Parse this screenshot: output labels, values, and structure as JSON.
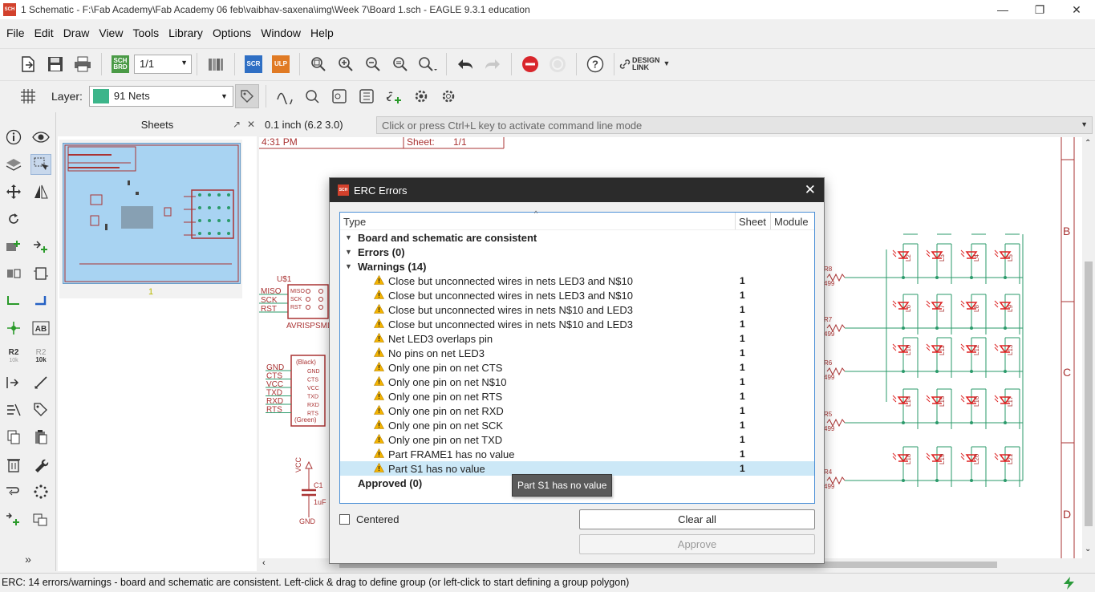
{
  "window": {
    "title": "1 Schematic - F:\\Fab Academy\\Fab Academy 06 feb\\vaibhav-saxena\\img\\Week 7\\Board 1.sch - EAGLE 9.3.1 education",
    "app_icon_text": "SCH",
    "minimize": "—",
    "restore": "❐",
    "close": "✕"
  },
  "menu": [
    "File",
    "Edit",
    "Draw",
    "View",
    "Tools",
    "Library",
    "Options",
    "Window",
    "Help"
  ],
  "toolbar": {
    "sheet_value": "1/1",
    "brd_badge": "SCH BRD",
    "scr_badge": "SCR",
    "ulp_badge": "ULP",
    "design_link_line1": "DESIGN",
    "design_link_line2": "LINK",
    "help_glyph": "?",
    "layer_label": "Layer:",
    "layer_value": "91 Nets",
    "layer_color": "#3cb58a"
  },
  "sheets_panel": {
    "title": "Sheets",
    "sheet_number": "1",
    "restore_glyph": "↗",
    "close_glyph": "✕"
  },
  "command": {
    "coordinates": "0.1 inch (6.2 3.0)",
    "placeholder": "Click or press Ctrl+L key to activate command line mode"
  },
  "schematic": {
    "time_text": "4:31 PM",
    "sheet_label": "Sheet:",
    "sheet_value": "1/1",
    "zone_labels": [
      "B",
      "C",
      "D"
    ],
    "pins_left": [
      "MISO",
      "SCK",
      "RST"
    ],
    "avr_ref": "U$1",
    "avr_name": "AVRISPSMD",
    "avr_pins": [
      "MISO",
      "SCK",
      "RST"
    ],
    "ftdi_pins_left": [
      "GND",
      "CTS",
      "VCC",
      "TXD",
      "RXD",
      "RTS"
    ],
    "ftdi_pins_inner": [
      "GND",
      "CTS",
      "VCC",
      "TXD",
      "RXD",
      "RTS"
    ],
    "ftdi_top": "(Black)",
    "ftdi_bottom": "(Green)",
    "vcc": "VCC",
    "cap_ref": "C1",
    "cap_value": "1uF",
    "gnd": "GND",
    "resistors": [
      {
        "ref": "R8",
        "value": "499"
      },
      {
        "ref": "R7",
        "value": "499"
      },
      {
        "ref": "R6",
        "value": "499"
      },
      {
        "ref": "R5",
        "value": "499"
      },
      {
        "ref": "R4",
        "value": "499"
      }
    ],
    "led_rows": [
      [
        "L2",
        "L3",
        "L4",
        "L5"
      ],
      [
        "L6",
        "L7",
        "L8",
        "L9"
      ],
      [
        "L10",
        "L11",
        "L12",
        "L13"
      ],
      [
        "L14",
        "L15",
        "L16",
        "L17"
      ],
      [
        "L18",
        "L19",
        "L20",
        "L21"
      ]
    ]
  },
  "dialog": {
    "title": "ERC Errors",
    "close_glyph": "✕",
    "columns": {
      "type": "Type",
      "sheet": "Sheet",
      "module": "Module"
    },
    "sort_glyph": "^",
    "groups": {
      "consistent": "Board and schematic are consistent",
      "errors": "Errors (0)",
      "warnings": "Warnings (14)",
      "approved": "Approved (0)"
    },
    "expander_glyph": "▼",
    "warnings": [
      {
        "text": "Close but unconnected wires in nets LED3 and N$10",
        "sheet": "1"
      },
      {
        "text": "Close but unconnected wires in nets LED3 and N$10",
        "sheet": "1"
      },
      {
        "text": "Close but unconnected wires in nets N$10 and LED3",
        "sheet": "1"
      },
      {
        "text": "Close but unconnected wires in nets N$10 and LED3",
        "sheet": "1"
      },
      {
        "text": "Net LED3 overlaps pin",
        "sheet": "1"
      },
      {
        "text": "No pins on net LED3",
        "sheet": "1"
      },
      {
        "text": "Only one pin on net CTS",
        "sheet": "1"
      },
      {
        "text": "Only one pin on net N$10",
        "sheet": "1"
      },
      {
        "text": "Only one pin on net RTS",
        "sheet": "1"
      },
      {
        "text": "Only one pin on net RXD",
        "sheet": "1"
      },
      {
        "text": "Only one pin on net SCK",
        "sheet": "1"
      },
      {
        "text": "Only one pin on net TXD",
        "sheet": "1"
      },
      {
        "text": "Part FRAME1 has no value",
        "sheet": "1"
      },
      {
        "text": "Part S1 has no value",
        "sheet": "1"
      }
    ],
    "tooltip": "Part S1 has no value",
    "centered_label": "Centered",
    "clear_all": "Clear all",
    "approve": "Approve"
  },
  "status": {
    "text": "ERC: 14 errors/warnings - board and schematic are consistent. Left-click & drag to define group (or left-click to start defining a group polygon)"
  }
}
